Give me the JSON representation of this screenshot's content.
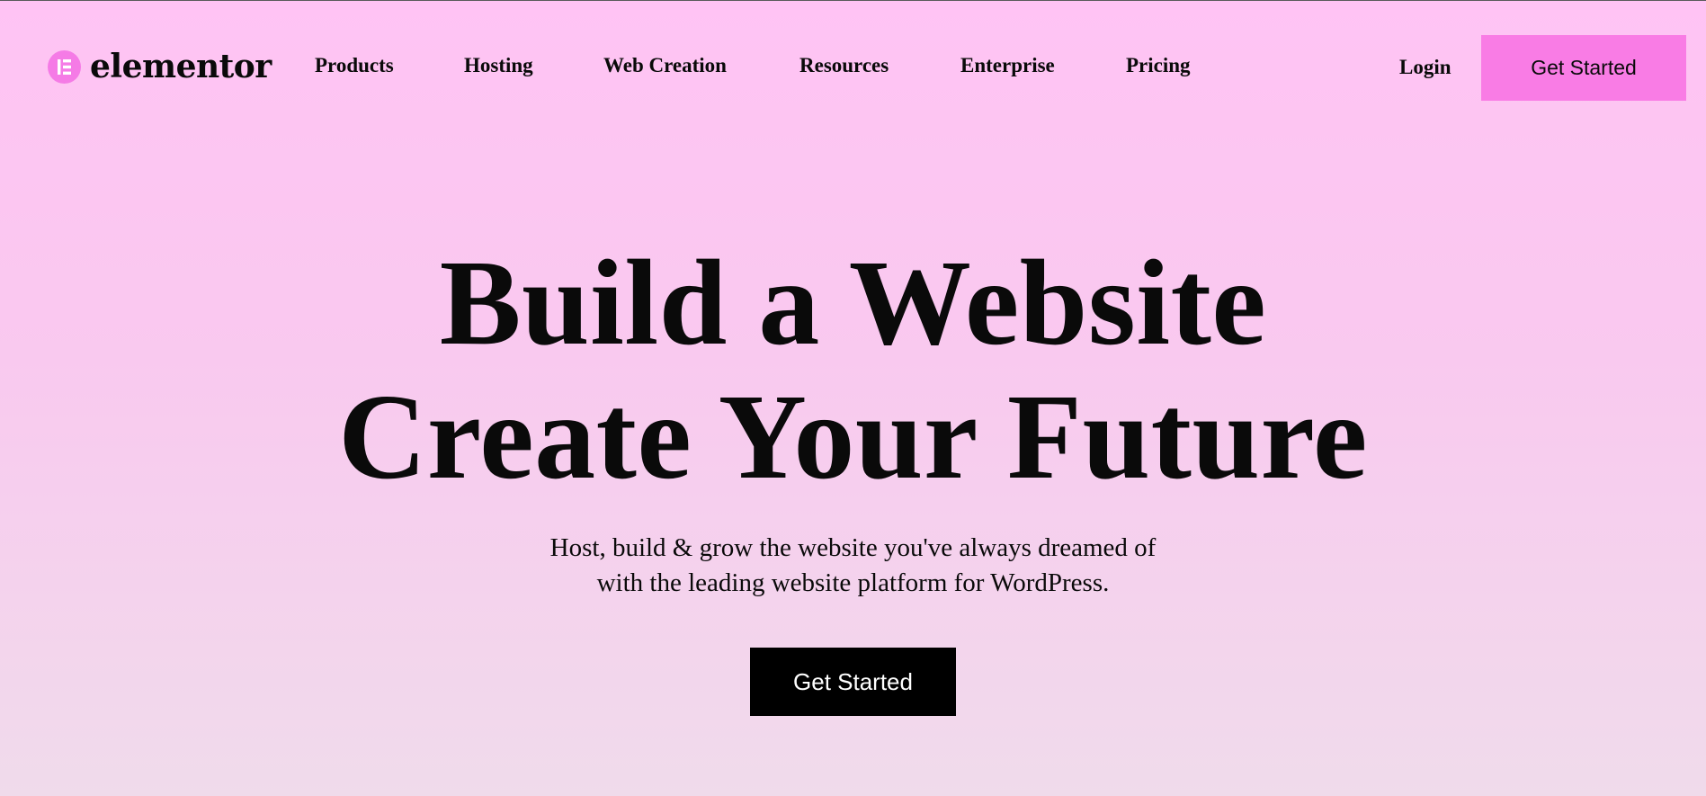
{
  "header": {
    "logo_text": "elementor",
    "logo_icon": "elementor-logo-icon",
    "nav": [
      {
        "label": "Products"
      },
      {
        "label": "Hosting"
      },
      {
        "label": "Web Creation"
      },
      {
        "label": "Resources"
      },
      {
        "label": "Enterprise"
      },
      {
        "label": "Pricing"
      }
    ],
    "login_label": "Login",
    "cta_label": "Get Started"
  },
  "hero": {
    "title_line1": "Build a Website",
    "title_line2": "Create Your Future",
    "subtitle_line1": "Host, build & grow the website you've always dreamed of",
    "subtitle_line2": "with the leading website platform for WordPress.",
    "cta_label": "Get Started"
  },
  "colors": {
    "accent": "#f97ce5",
    "background_top": "#ffc3f4",
    "background_bottom": "#f0dbeb",
    "hero_button": "#000000"
  }
}
